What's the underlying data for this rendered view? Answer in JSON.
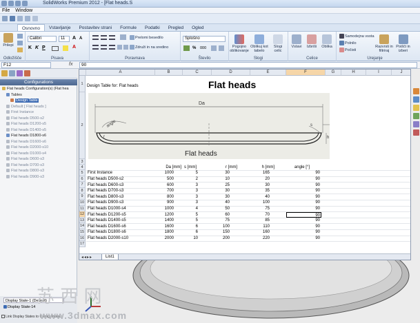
{
  "titlebar": {
    "title": "SolidWorks Premium 2012 - [Flat heads.S"
  },
  "menubar": {
    "items": [
      "File",
      "Window"
    ]
  },
  "ribbon": {
    "tabs": [
      "Osnovno",
      "Vstavljanje",
      "Postavitev strani",
      "Formule",
      "Podatki",
      "Pregled",
      "Ogled"
    ],
    "active_tab": "Osnovno",
    "groups": {
      "clipboard": {
        "label": "Odložišče",
        "paste_label": "Prilepi"
      },
      "font": {
        "label": "Pisava",
        "font_name": "Calibri",
        "font_size": "11"
      },
      "alignment": {
        "label": "Poravnava",
        "wrap_label": "Prelomi besedilo",
        "merge_label": "Združi in na sredino"
      },
      "number": {
        "label": "Število",
        "format_value": "Splošno",
        "percent": "%",
        "comma": "000"
      },
      "styles": {
        "label": "Slogi",
        "conditional": "Pogojno oblikovanje",
        "as_table": "Oblikuj kot tabelo",
        "cell_styles": "Slogi celic"
      },
      "cells": {
        "label": "Celice",
        "insert": "Vstavi",
        "delete": "Izbriši",
        "format": "Oblika"
      },
      "editing": {
        "label": "Urejanje",
        "autosum": "Samodejna vsota",
        "fill": "Polnilo",
        "clear": "Počisti",
        "sort": "Razvrsti in filtriraj",
        "find": "Poišči in izberi"
      }
    }
  },
  "formula_bar": {
    "name_box": "F12",
    "fx": "fx",
    "value": "90"
  },
  "left_panel": {
    "header": "Configurations",
    "tree": [
      {
        "label": "Flat heads Configuration(s)  (Flat hea",
        "style": "dark",
        "indent": 0
      },
      {
        "label": "Tables",
        "style": "dark",
        "indent": 1
      },
      {
        "label": "Design Table",
        "style": "selected",
        "indent": 2
      },
      {
        "label": "Default [ Flat heads ]",
        "style": "grey",
        "indent": 1
      },
      {
        "label": "First Instance",
        "style": "grey",
        "indent": 1
      },
      {
        "label": "Flat heads D500-s2",
        "style": "grey",
        "indent": 1
      },
      {
        "label": "Flat heads D1200-s5",
        "style": "grey",
        "indent": 1
      },
      {
        "label": "Flat heads D1400-s5",
        "style": "grey",
        "indent": 1
      },
      {
        "label": "Flat heads D1800-s6",
        "style": "dark",
        "indent": 1
      },
      {
        "label": "Flat heads D1600-s6",
        "style": "grey",
        "indent": 1
      },
      {
        "label": "Flat heads D2000-s10",
        "style": "grey",
        "indent": 1
      },
      {
        "label": "Flat heads D1000-s4",
        "style": "grey",
        "indent": 1
      },
      {
        "label": "Flat heads D600-s3",
        "style": "grey",
        "indent": 1
      },
      {
        "label": "Flat heads D700-s3",
        "style": "grey",
        "indent": 1
      },
      {
        "label": "Flat heads D800-s3",
        "style": "grey",
        "indent": 1
      },
      {
        "label": "Flat heads D900-s3",
        "style": "grey",
        "indent": 1
      }
    ],
    "display_state_1": "Display State-1 (Default)",
    "display_state_2": "Display State-14",
    "link_text": "Link Display States to Configurations"
  },
  "sheet": {
    "columns": [
      "A",
      "B",
      "C",
      "D",
      "E",
      "F",
      "G",
      "H",
      "I",
      "J"
    ],
    "active_column": "F",
    "active_row": 12,
    "row_numbers": [
      "1",
      "2",
      "3",
      "4",
      "5",
      "6",
      "7",
      "8",
      "9",
      "10",
      "11",
      "12",
      "13",
      "14",
      "15",
      "16",
      "17"
    ],
    "a1": "Design Table for: Flat heads",
    "title": "Flat heads",
    "drawing": {
      "da_label": "Da",
      "r_label": "r",
      "s_label": "s",
      "h_label": "h",
      "angle_label": "angle",
      "caption": "Flat heads"
    },
    "headers": [
      "Da [mm]",
      "s [mm]",
      "r [mm]",
      "h [mm]",
      "angle [°]"
    ],
    "rows": [
      {
        "name": "First Instance",
        "da": "1000",
        "s": "5",
        "r": "30",
        "h": "165",
        "angle": "90"
      },
      {
        "name": "Flat heads D500-s2",
        "da": "500",
        "s": "2",
        "r": "10",
        "h": "20",
        "angle": "90"
      },
      {
        "name": "Flat heads D600-s3",
        "da": "600",
        "s": "3",
        "r": "25",
        "h": "30",
        "angle": "90"
      },
      {
        "name": "Flat heads D700-s3",
        "da": "700",
        "s": "3",
        "r": "30",
        "h": "35",
        "angle": "90"
      },
      {
        "name": "Flat heads D800-s3",
        "da": "800",
        "s": "3",
        "r": "30",
        "h": "40",
        "angle": "90"
      },
      {
        "name": "Flat heads D900-s3",
        "da": "900",
        "s": "3",
        "r": "40",
        "h": "100",
        "angle": "90"
      },
      {
        "name": "Flat heads D1000-s4",
        "da": "1000",
        "s": "4",
        "r": "50",
        "h": "75",
        "angle": "90"
      },
      {
        "name": "Flat heads D1200-s5",
        "da": "1200",
        "s": "5",
        "r": "60",
        "h": "70",
        "angle": "90"
      },
      {
        "name": "Flat heads D1400-s5",
        "da": "1400",
        "s": "5",
        "r": "75",
        "h": "85",
        "angle": "90"
      },
      {
        "name": "Flat heads D1600-s6",
        "da": "1600",
        "s": "6",
        "r": "100",
        "h": "110",
        "angle": "90"
      },
      {
        "name": "Flat heads D1800-s6",
        "da": "1800",
        "s": "6",
        "r": "150",
        "h": "160",
        "angle": "90"
      },
      {
        "name": "Flat heads D2000-s10",
        "da": "2000",
        "s": "10",
        "r": "200",
        "h": "220",
        "angle": "90"
      }
    ],
    "sheet_tab": "List1"
  },
  "watermark": {
    "cn": "苏 西 网",
    "url": "www.3dmax.com"
  },
  "colors": {
    "selection_blue": "#3d6bb3",
    "header_bg": "#e4e9f1",
    "ribbon_bg": "#dde7f3",
    "active_cell_fill": "#f6d6a8"
  }
}
